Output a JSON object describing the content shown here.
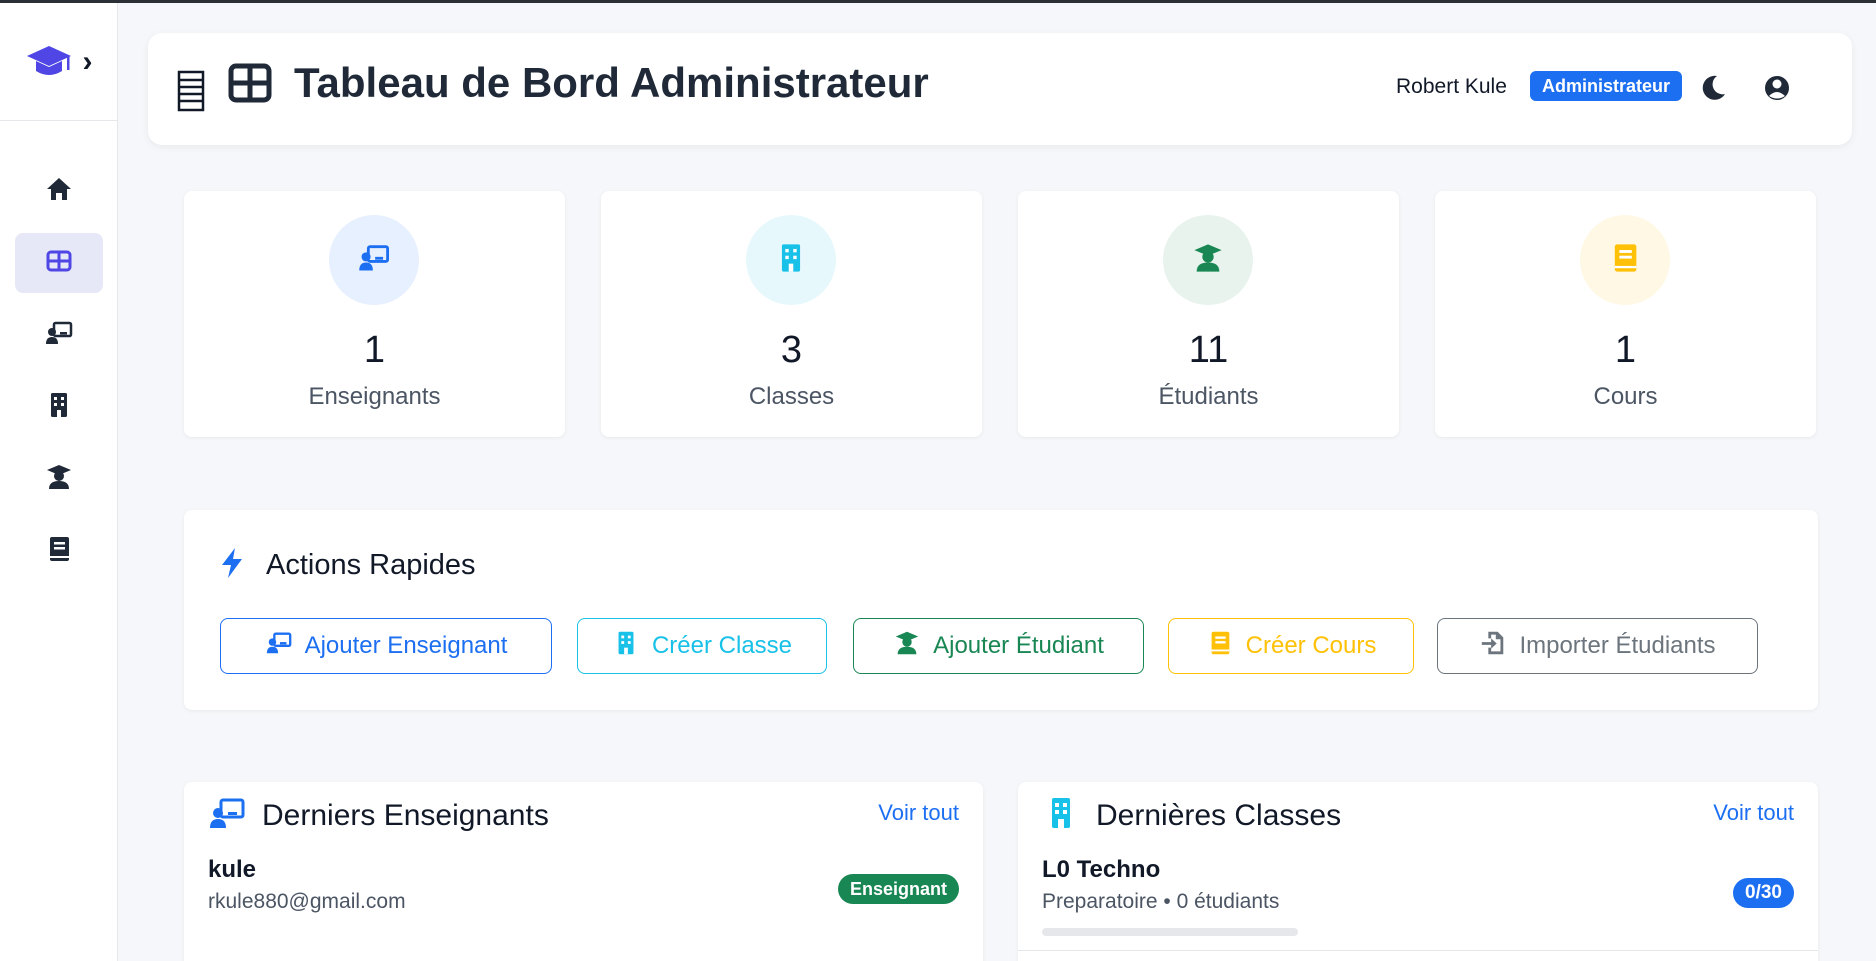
{
  "app": {
    "title": "Tableau de Bord Administrateur"
  },
  "sidebar": {
    "logo_icon": "graduation-cap-icon",
    "toggle_icon": "chevron-right-icon",
    "items": [
      {
        "name": "home",
        "icon": "home-icon"
      },
      {
        "name": "dashboard",
        "icon": "grid-icon",
        "active": true
      },
      {
        "name": "teachers",
        "icon": "teacher-icon"
      },
      {
        "name": "classes",
        "icon": "building-icon"
      },
      {
        "name": "students",
        "icon": "student-icon"
      },
      {
        "name": "courses",
        "icon": "book-icon"
      }
    ]
  },
  "header": {
    "user_name": "Robert Kule",
    "role": "Administrateur"
  },
  "stats": [
    {
      "value": "1",
      "label": "Enseignants",
      "color": "#1d6ff2",
      "bg": "#e7f0fe"
    },
    {
      "value": "3",
      "label": "Classes",
      "color": "#17c1e8",
      "bg": "#e6f8fc"
    },
    {
      "value": "11",
      "label": "Étudiants",
      "color": "#198754",
      "bg": "#e8f3ed"
    },
    {
      "value": "1",
      "label": "Cours",
      "color": "#ffc107",
      "bg": "#fff8e5"
    }
  ],
  "actions": {
    "title": "Actions Rapides",
    "buttons": [
      {
        "label": "Ajouter Enseignant",
        "color": "#1d6ff2"
      },
      {
        "label": "Créer Classe",
        "color": "#17c1e8"
      },
      {
        "label": "Ajouter Étudiant",
        "color": "#198754"
      },
      {
        "label": "Créer Cours",
        "color": "#ffc107"
      },
      {
        "label": "Importer Étudiants",
        "color": "#6c757d"
      }
    ]
  },
  "recent_teachers": {
    "title": "Derniers Enseignants",
    "see_all": "Voir tout",
    "items": [
      {
        "name": "kule",
        "email": "rkule880@gmail.com",
        "badge": "Enseignant"
      }
    ]
  },
  "recent_classes": {
    "title": "Dernières Classes",
    "see_all": "Voir tout",
    "items": [
      {
        "name": "L0 Techno",
        "subtitle": "Preparatoire • 0 étudiants",
        "capacity": "0/30",
        "fill_fraction": 0
      }
    ]
  }
}
